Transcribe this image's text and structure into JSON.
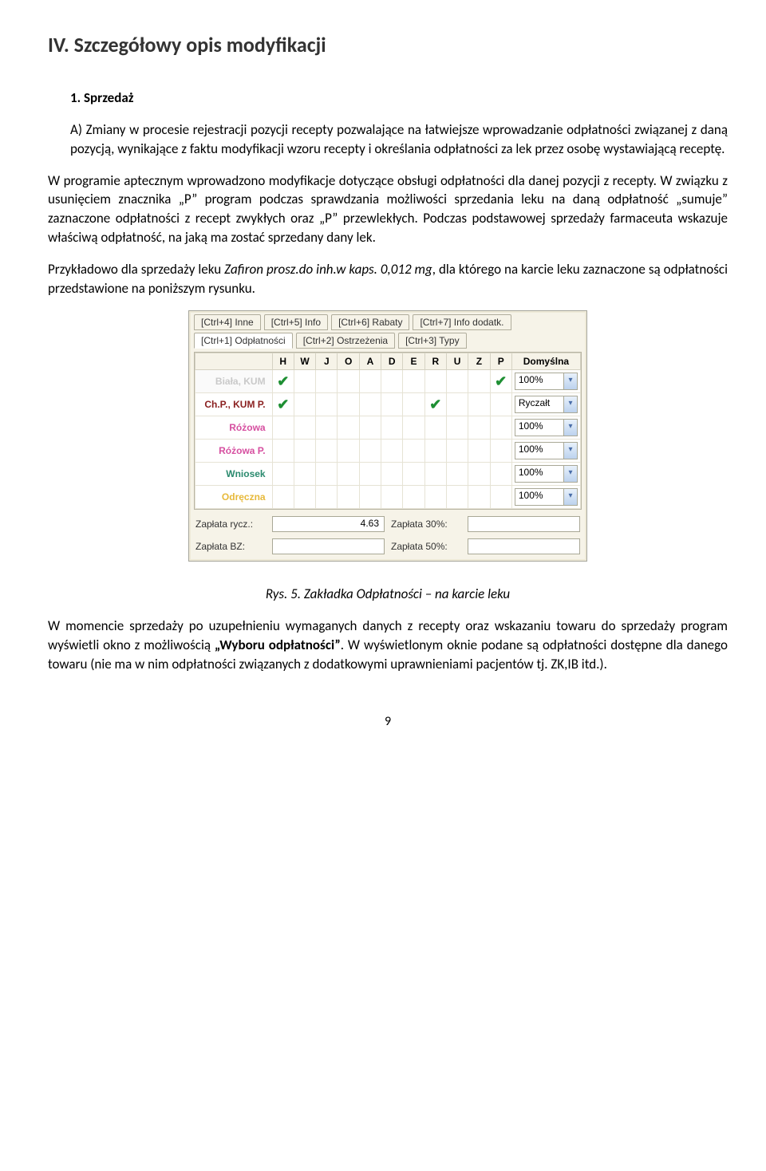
{
  "heading": "IV.   Szczegółowy opis modyfikacji",
  "subhead": "1.  Sprzedaż",
  "paraA": "A)  Zmiany w procesie rejestracji pozycji recepty pozwalające na łatwiejsze wprowadzanie odpłatności związanej z daną pozycją, wynikające z faktu modyfikacji wzoru recepty i określania odpłatności za lek przez osobę wystawiającą receptę.",
  "para2": "W programie aptecznym wprowadzono modyfikacje dotyczące obsługi odpłatności dla danej pozycji z recepty. W związku z usunięciem znacznika „P” program podczas sprawdzania możliwości sprzedania leku na daną odpłatność „sumuje” zaznaczone odpłatności z recept zwykłych oraz „P” przewlekłych. Podczas podstawowej sprzedaży farmaceuta wskazuje właściwą odpłatność, na jaką ma zostać sprzedany dany lek.",
  "para3a": "Przykładowo dla sprzedaży leku ",
  "para3_em": "Zafiron prosz.do inh.w kaps. 0,012 mg",
  "para3b": ", dla którego na karcie leku zaznaczone są odpłatności przedstawione na poniższym rysunku.",
  "figcap": "Rys. 5. Zakładka Odpłatności – na karcie leku",
  "para4a": "W momencie sprzedaży po uzupełnieniu wymaganych danych z recepty oraz wskazaniu towaru do sprzedaży program wyświetli okno z możliwością ",
  "para4_bold": "„Wyboru odpłatności”",
  "para4b": ". W wyświetlonym oknie podane są odpłatności dostępne dla danego towaru (nie ma w nim odpłatności związanych z dodatkowymi uprawnieniami pacjentów tj. ZK,IB itd.).",
  "pagenum": "9",
  "ui": {
    "tabs_top": [
      "[Ctrl+4] Inne",
      "[Ctrl+5] Info",
      "[Ctrl+6] Rabaty",
      "[Ctrl+7] Info dodatk."
    ],
    "tabs_bot": [
      "[Ctrl+1] Odpłatności",
      "[Ctrl+2] Ostrzeżenia",
      "[Ctrl+3] Typy"
    ],
    "cols": [
      "",
      "H",
      "W",
      "J",
      "O",
      "A",
      "D",
      "E",
      "R",
      "U",
      "Z",
      "P",
      "Domyślna"
    ],
    "rows": [
      {
        "label": "Biała, KUM",
        "cls": "lbl-biala",
        "checks": [
          1,
          0,
          0,
          0,
          0,
          0,
          0,
          0,
          0,
          0,
          1
        ],
        "combo": "100%"
      },
      {
        "label": "Ch.P., KUM P.",
        "cls": "lbl-chp",
        "checks": [
          1,
          0,
          0,
          0,
          0,
          0,
          0,
          1,
          0,
          0,
          0
        ],
        "combo": "Ryczałt"
      },
      {
        "label": "Różowa",
        "cls": "lbl-rozowa",
        "checks": [
          0,
          0,
          0,
          0,
          0,
          0,
          0,
          0,
          0,
          0,
          0
        ],
        "combo": "100%"
      },
      {
        "label": "Różowa P.",
        "cls": "lbl-rozowap",
        "checks": [
          0,
          0,
          0,
          0,
          0,
          0,
          0,
          0,
          0,
          0,
          0
        ],
        "combo": "100%"
      },
      {
        "label": "Wniosek",
        "cls": "lbl-wniosek",
        "checks": [
          0,
          0,
          0,
          0,
          0,
          0,
          0,
          0,
          0,
          0,
          0
        ],
        "combo": "100%"
      },
      {
        "label": "Odręczna",
        "cls": "lbl-odreczna",
        "checks": [
          0,
          0,
          0,
          0,
          0,
          0,
          0,
          0,
          0,
          0,
          0
        ],
        "combo": "100%"
      }
    ],
    "pay": {
      "rycz_label": "Zapłata rycz.:",
      "rycz_val": "4.63",
      "p30_label": "Zapłata 30%:",
      "p30_val": "",
      "bz_label": "Zapłata BZ:",
      "bz_val": "",
      "p50_label": "Zapłata 50%:",
      "p50_val": ""
    }
  }
}
